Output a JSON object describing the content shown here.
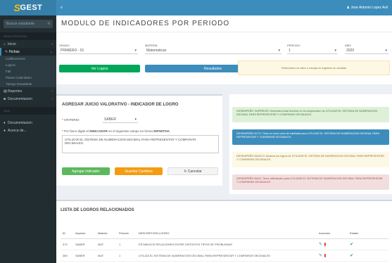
{
  "app": {
    "logo_s": "S",
    "logo_text": "GEST"
  },
  "sidebar": {
    "search_placeholder": "Buscar estudiante",
    "search_icon": "search-icon",
    "header": "MENU PRINCIPAL",
    "items": [
      {
        "label": "Inicio",
        "icon": "home-icon"
      },
      {
        "label": "Fichas",
        "icon": "file-icon"
      }
    ],
    "subitems": [
      "Calificaciones",
      "Logros",
      "Falt",
      "Planes Calendario",
      "Tiempo Estudiante"
    ],
    "items2": [
      {
        "label": "Reportes",
        "icon": "chart-icon"
      },
      {
        "label": "Documentacion",
        "icon": "folder-icon"
      }
    ],
    "header2": "ADM",
    "items3": [
      {
        "label": "Documentacion",
        "icon": "book-icon"
      },
      {
        "label": "Acerca de...",
        "icon": "info-icon"
      }
    ]
  },
  "topbar": {
    "menu_icon": "menu-icon",
    "user": "Jose Antonio Lopez Avil"
  },
  "main": {
    "title": "MODULO DE INDICADORES POR PERIODO",
    "filters": [
      {
        "label": "GRADO",
        "value": "PRIMERO - 01"
      },
      {
        "label": "MATERIA",
        "value": "Matematicas"
      },
      {
        "label": "PERIODO",
        "value": "1"
      },
      {
        "label": "AÑO",
        "value": "2020"
      }
    ],
    "btn_logros": "Ver Logros",
    "btn_resultados": "Resultados",
    "warning": "Selecciona un valor o escoja en ingresar un escalas"
  },
  "form": {
    "title": "AGREGAR JUICIO VALORATIVO - INDICADOR DE LOGRO",
    "tipo_label": "* CRITERIO",
    "tipo_value": "SABER",
    "instruction_1": "* Por favor digite el ",
    "instruction_bold": "INDICADOR",
    "instruction_2": " en el siguiente campo en forma ",
    "instruction_end": "INFINITIVA",
    "textarea": "UTILIZAR EL SISTEMA DE NUMERACION DECIMAL PARA REPRESENTAR Y COMPARAR DECIMALES.",
    "btn_agregar": "Agregar Indicador",
    "btn_guardar": "Guardar Cambios",
    "btn_cancelar": "Cancelar"
  },
  "levels": [
    {
      "text": "DESEMPEÑO SUPERIOR: Demuestra total dominio en la comprension de UTILIZAR EL SISTEMA DE NUMERACION DECIMAL PARA REPRESENTAR Y COMPARAR DECIMALES.",
      "bg": "#dff0d8",
      "fg": "#3c763d"
    },
    {
      "text": "DESEMPEÑO ALTO: Tiene un buen nivel de habilidad para UTILIZAR EL SISTEMA DE NUMERACION DECIMAL PARA REPRESENTAR Y COMPARAR DECIMALES.",
      "bg": "#3c8dbc",
      "fg": "#ffffff"
    },
    {
      "text": "DESEMPEÑO BASICO: Alcanza los logros de UTILIZAR EL SISTEMA DE NUMERACION DECIMAL PARA REPRESENTAR Y COMPARAR DECIMALES.",
      "bg": "#fcf8e3",
      "fg": "#8a6d3b"
    },
    {
      "text": "DESEMPEÑO BAJO: Tiene dificultades para UTILIZAR EL SISTEMA DE NUMERACION DECIMAL PARA REPRESENTAR Y COMPARAR DECIMALES.",
      "bg": "#f2dede",
      "fg": "#a94442"
    }
  ],
  "list": {
    "title": "LISTA DE LOGROS RELACIONADOS",
    "columns": [
      "ID",
      "Aspecto",
      "Materia",
      "Periodo",
      "DESCRIPCION LOGRO",
      "Acciones",
      "Estado"
    ],
    "rows": [
      {
        "id": "373",
        "aspecto": "SABER",
        "materia": "MAT",
        "periodo": "1",
        "descripcion": "ESTABLECE RELACIONES ENTRE DISTINTOS TIPOS DE PROBLEMAS"
      },
      {
        "id": "380",
        "aspecto": "SABER",
        "materia": "MAT",
        "periodo": "1",
        "descripcion": "UTILIZA EL SISTEMA DE NUMERACION DECIMAL PARA REPRESENTAR Y COMPARAR DECIMALES"
      }
    ]
  }
}
